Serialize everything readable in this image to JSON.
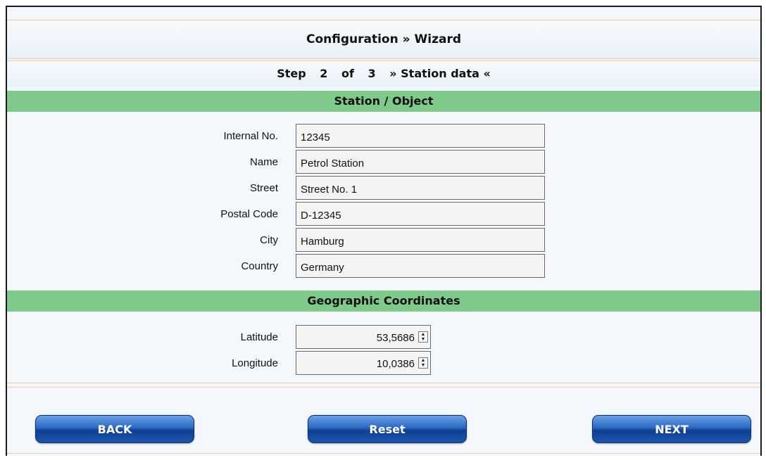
{
  "header": {
    "title": "Configuration » Wizard"
  },
  "step": {
    "word": "Step",
    "current": "2",
    "of": "of",
    "total": "3",
    "name": "» Station data «"
  },
  "station_section": {
    "title": "Station / Object",
    "fields": [
      {
        "label": "Internal No.",
        "value": "12345"
      },
      {
        "label": "Name",
        "value": "Petrol Station"
      },
      {
        "label": "Street",
        "value": "Street No. 1"
      },
      {
        "label": "Postal Code",
        "value": "D-12345"
      },
      {
        "label": "City",
        "value": "Hamburg"
      },
      {
        "label": "Country",
        "value": "Germany"
      }
    ]
  },
  "geo_section": {
    "title": "Geographic Coordinates",
    "latitude": {
      "label": "Latitude",
      "value": "53,5686"
    },
    "longitude": {
      "label": "Longitude",
      "value": "10,0386"
    }
  },
  "buttons": {
    "back": "BACK",
    "reset": "Reset",
    "next": "NEXT"
  },
  "colors": {
    "section_header": "#7fc98a",
    "button_blue": "#1c55ad",
    "separator": "#f2c9a0"
  },
  "icons": {
    "spinner": "spin-updown-icon"
  }
}
